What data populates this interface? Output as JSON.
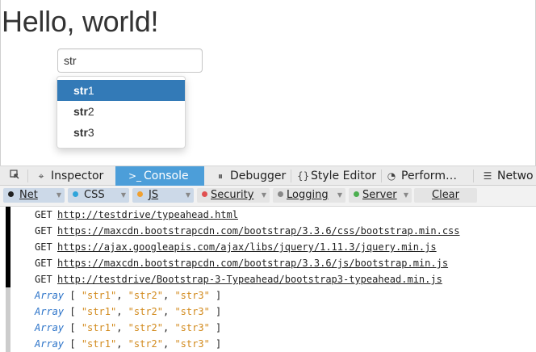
{
  "page": {
    "heading": "Hello, world!",
    "input_value": "str",
    "suggestions": [
      {
        "bold": "str",
        "rest": "1"
      },
      {
        "bold": "str",
        "rest": "2"
      },
      {
        "bold": "str",
        "rest": "3"
      }
    ],
    "active_index": 0
  },
  "devtools": {
    "tabs": [
      {
        "label": "Inspector"
      },
      {
        "label": "Console"
      },
      {
        "label": "Debugger"
      },
      {
        "label": "Style Editor"
      },
      {
        "label": "Perform…"
      },
      {
        "label": "Netwo"
      }
    ],
    "selected_tab": "Console",
    "filters": [
      {
        "label": "Net",
        "color": "#222222",
        "on": true
      },
      {
        "label": "CSS",
        "color": "#2fa4da",
        "on": true
      },
      {
        "label": "JS",
        "color": "#f0a030",
        "on": true
      },
      {
        "label": "Security",
        "color": "#e05050",
        "on": false
      },
      {
        "label": "Logging",
        "color": "#888888",
        "on": false
      },
      {
        "label": "Server",
        "color": "#4caf50",
        "on": false
      }
    ],
    "clear_label": "Clear",
    "requests": [
      {
        "verb": "GET",
        "url": "http://testdrive/typeahead.html"
      },
      {
        "verb": "GET",
        "url": "https://maxcdn.bootstrapcdn.com/bootstrap/3.3.6/css/bootstrap.min.css"
      },
      {
        "verb": "GET",
        "url": "https://ajax.googleapis.com/ajax/libs/jquery/1.11.3/jquery.min.js"
      },
      {
        "verb": "GET",
        "url": "https://maxcdn.bootstrapcdn.com/bootstrap/3.3.6/js/bootstrap.min.js"
      },
      {
        "verb": "GET",
        "url": "http://testdrive/Bootstrap-3-Typeahead/bootstrap3-typeahead.min.js"
      }
    ],
    "array_logs": [
      {
        "keyword": "Array",
        "open": "[",
        "items": [
          "\"str1\"",
          "\"str2\"",
          "\"str3\""
        ],
        "close": "]"
      },
      {
        "keyword": "Array",
        "open": "[",
        "items": [
          "\"str1\"",
          "\"str2\"",
          "\"str3\""
        ],
        "close": "]"
      },
      {
        "keyword": "Array",
        "open": "[",
        "items": [
          "\"str1\"",
          "\"str2\"",
          "\"str3\""
        ],
        "close": "]"
      },
      {
        "keyword": "Array",
        "open": "[",
        "items": [
          "\"str1\"",
          "\"str2\"",
          "\"str3\""
        ],
        "close": "]"
      }
    ]
  }
}
